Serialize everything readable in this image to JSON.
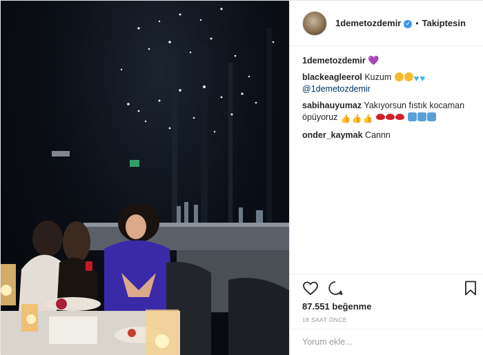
{
  "header": {
    "username": "1demetozdemir",
    "follow_status": "Takiptesin",
    "separator": "•"
  },
  "caption": {
    "username": "1demetozdemir",
    "emoji": "💜"
  },
  "comments": [
    {
      "user": "blackeagleerol",
      "text": "Kuzum",
      "mention": "@1demetozdemir"
    },
    {
      "user": "sabihauyumaz",
      "text": "Yakıyorsun fıstık kocaman öpüyoruz"
    },
    {
      "user": "onder_kaymak",
      "text": "Cannn"
    }
  ],
  "stats": {
    "likes": "87.551 beğenme",
    "time": "18 SAAT ÖNCE"
  },
  "add_comment": {
    "placeholder": "Yorum ekle..."
  },
  "colors": {
    "link": "#003569",
    "verified": "#3897f0",
    "muted": "#999999",
    "border": "#efefef"
  },
  "icons": [
    "heart-icon",
    "comment-icon",
    "bookmark-icon",
    "verified-badge-icon"
  ]
}
